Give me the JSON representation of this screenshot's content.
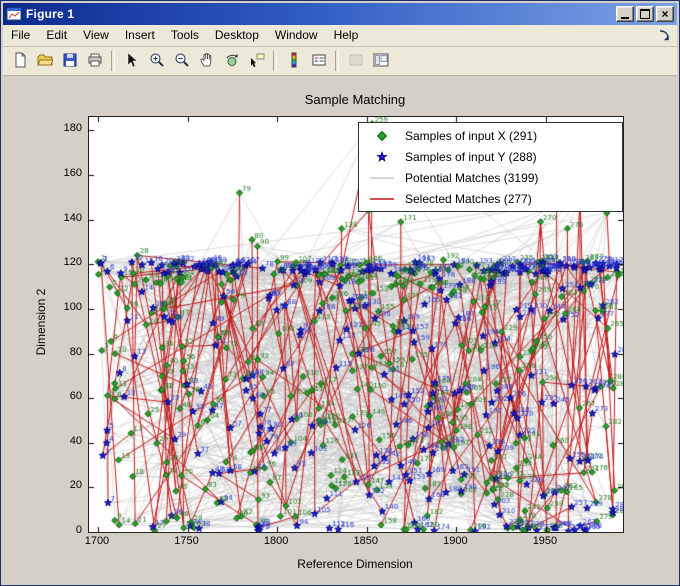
{
  "window": {
    "title": "Figure 1",
    "controls": {
      "minimize": "minimize",
      "maximize": "maximize",
      "close_glyph": "×"
    }
  },
  "menubar": {
    "items": [
      "File",
      "Edit",
      "View",
      "Insert",
      "Tools",
      "Desktop",
      "Window",
      "Help"
    ],
    "dock_tooltip": "Dock Figure"
  },
  "toolbar": {
    "buttons": [
      {
        "name": "new-figure",
        "tooltip": "New Figure",
        "icon": "new"
      },
      {
        "name": "open-file",
        "tooltip": "Open File",
        "icon": "open"
      },
      {
        "name": "save-figure",
        "tooltip": "Save Figure",
        "icon": "save"
      },
      {
        "name": "print-figure",
        "tooltip": "Print Figure",
        "icon": "print"
      },
      {
        "name": "edit-plot",
        "tooltip": "Edit Plot",
        "icon": "cursor",
        "separator_before": true
      },
      {
        "name": "zoom-in",
        "tooltip": "Zoom In",
        "icon": "zoomin"
      },
      {
        "name": "zoom-out",
        "tooltip": "Zoom Out",
        "icon": "zoomout"
      },
      {
        "name": "pan",
        "tooltip": "Pan",
        "icon": "pan"
      },
      {
        "name": "rotate-3d",
        "tooltip": "Rotate 3D",
        "icon": "rotate"
      },
      {
        "name": "data-cursor",
        "tooltip": "Data Cursor",
        "icon": "datacursor"
      },
      {
        "name": "insert-colorbar",
        "tooltip": "Insert Colorbar",
        "icon": "colorbar",
        "separator_before": true
      },
      {
        "name": "insert-legend",
        "tooltip": "Insert Legend",
        "icon": "legend"
      },
      {
        "name": "hide-plot-tools",
        "tooltip": "Hide Plot Tools",
        "icon": "tools_off",
        "separator_before": true,
        "disabled": true
      },
      {
        "name": "show-plot-tools",
        "tooltip": "Show Plot Tools and Dock Figure",
        "icon": "tools_on"
      }
    ]
  },
  "chart_data": {
    "type": "scatter",
    "title": "Sample Matching",
    "xlabel": "Reference Dimension",
    "ylabel": "Dimension 2",
    "xlim": [
      1695,
      1993
    ],
    "ylim": [
      0,
      186
    ],
    "xticks": [
      1700,
      1750,
      1800,
      1850,
      1900,
      1950
    ],
    "yticks": [
      0,
      20,
      40,
      60,
      80,
      100,
      120,
      140,
      160,
      180
    ],
    "grid": false,
    "legend_position": "top-right",
    "point_label_style": "sample index printed beside every marker",
    "series": [
      {
        "name": "Samples of input X",
        "count": 291,
        "marker": "diamond",
        "color": "#2e9e2e",
        "label_color": "#1c7a1c"
      },
      {
        "name": "Samples of input Y",
        "count": 288,
        "marker": "pentagram",
        "color": "#2020dd",
        "label_color": "#2233cc"
      },
      {
        "name": "Potential Matches",
        "count": 3199,
        "style": "line",
        "color": "#cccccc"
      },
      {
        "name": "Selected Matches",
        "count": 277,
        "style": "line",
        "color": "#c21818"
      }
    ],
    "legend": [
      {
        "label": "Samples of input X (291)"
      },
      {
        "label": "Samples of input Y (288)"
      },
      {
        "label": "Potential Matches (3199)"
      },
      {
        "label": "Selected Matches (277)"
      }
    ],
    "notable_points": [
      {
        "x": 1722,
        "y": 124,
        "label": "28",
        "series": "X"
      },
      {
        "x": 1779,
        "y": 152,
        "label": "79",
        "series": "X"
      },
      {
        "x": 1786,
        "y": 131,
        "label": "80",
        "series": "X"
      },
      {
        "x": 1789,
        "y": 128,
        "label": "90",
        "series": "X"
      },
      {
        "x": 1836,
        "y": 136,
        "label": "138",
        "series": "X"
      },
      {
        "x": 1851,
        "y": 144,
        "label": "149",
        "series": "X"
      },
      {
        "x": 1869,
        "y": 139,
        "label": "171",
        "series": "X"
      },
      {
        "x": 1853,
        "y": 183,
        "label": "259",
        "series": "X"
      },
      {
        "x": 1947,
        "y": 139,
        "label": "270",
        "series": "X"
      },
      {
        "x": 1956,
        "y": 147,
        "label": "274",
        "series": "X"
      },
      {
        "x": 1962,
        "y": 136,
        "label": "276",
        "series": "X"
      },
      {
        "x": 1969,
        "y": 150,
        "label": "280",
        "series": "X"
      },
      {
        "x": 1984,
        "y": 143,
        "label": "288",
        "series": "X"
      }
    ]
  }
}
